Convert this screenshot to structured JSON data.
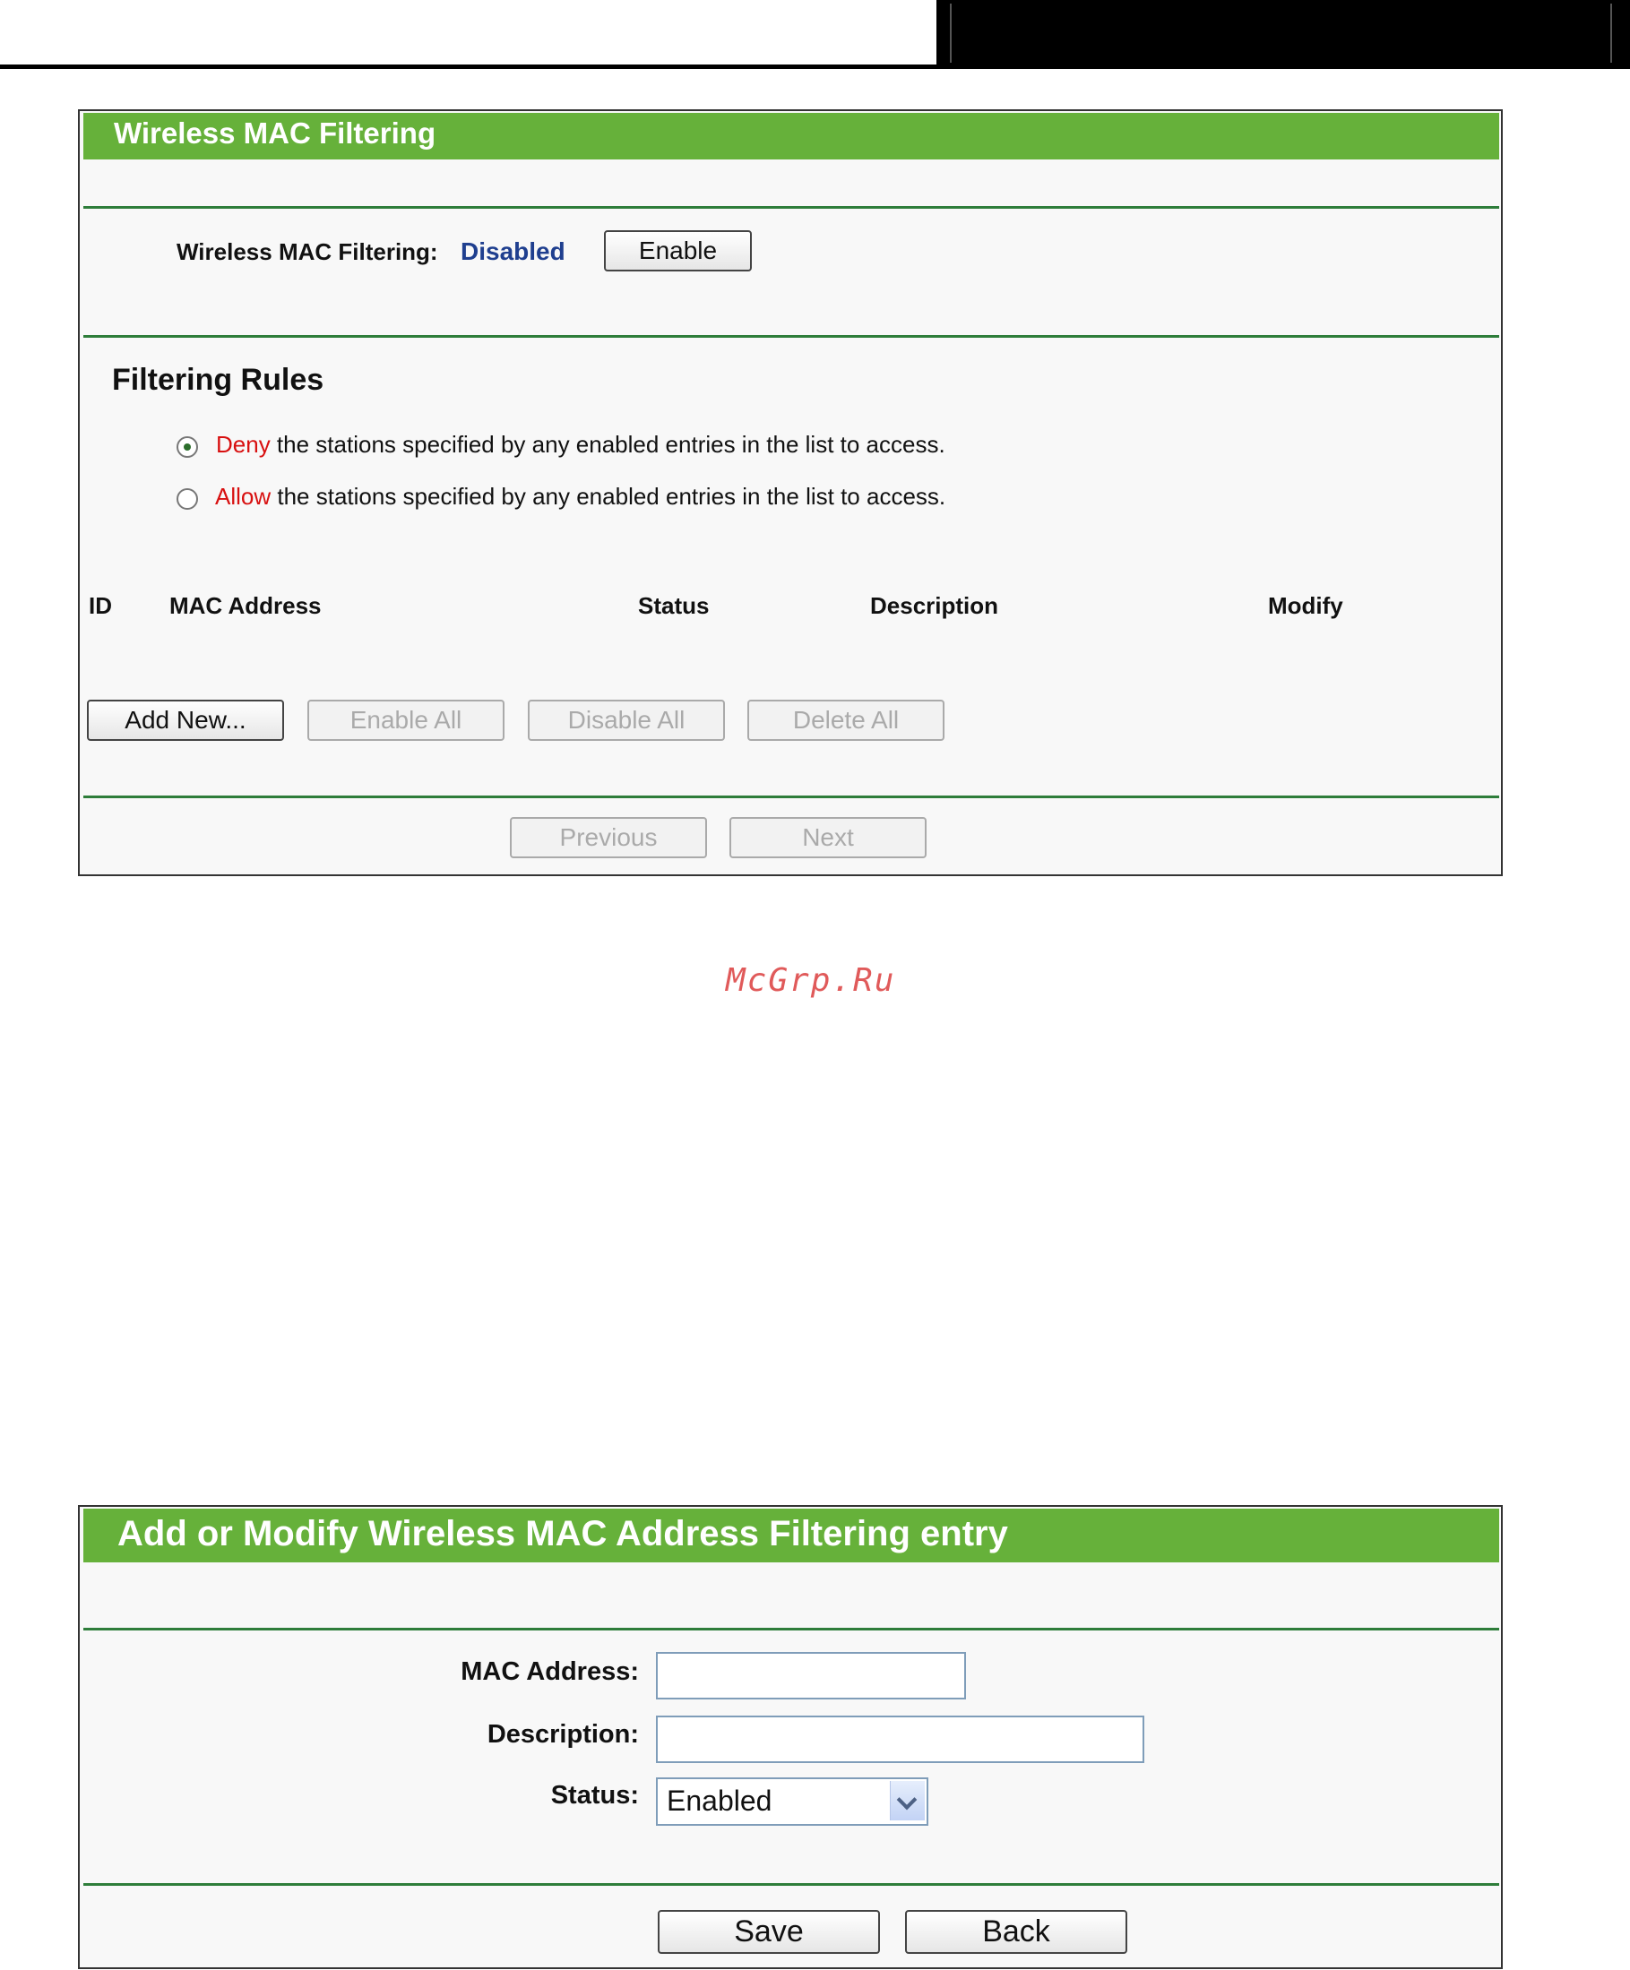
{
  "watermark": "McGrp.Ru",
  "panel1": {
    "title": "Wireless MAC Filtering",
    "filter_label": "Wireless MAC Filtering:",
    "filter_status": "Disabled",
    "enable_button": "Enable",
    "rules_heading": "Filtering Rules",
    "rule_options": [
      {
        "keyword": "Deny",
        "text": " the stations specified by any enabled entries in the list to access.",
        "selected": true
      },
      {
        "keyword": "Allow",
        "text": " the stations specified by any enabled entries in the list to access.",
        "selected": false
      }
    ],
    "table_headers": [
      "ID",
      "MAC Address",
      "Status",
      "Description",
      "Modify"
    ],
    "actions": [
      "Add New...",
      "Enable All",
      "Disable All",
      "Delete All"
    ],
    "pager": [
      "Previous",
      "Next"
    ]
  },
  "panel2": {
    "title": "Add or Modify Wireless MAC Address Filtering entry",
    "mac_label": "MAC Address:",
    "mac_value": "",
    "description_label": "Description:",
    "description_value": "",
    "status_label": "Status:",
    "status_value": "Enabled",
    "save_button": "Save",
    "back_button": "Back"
  },
  "colors": {
    "header_green": "#66b13a",
    "divider_green": "#2e7d3a",
    "status_blue": "#1f3f8f",
    "keyword_red": "#d81010"
  }
}
